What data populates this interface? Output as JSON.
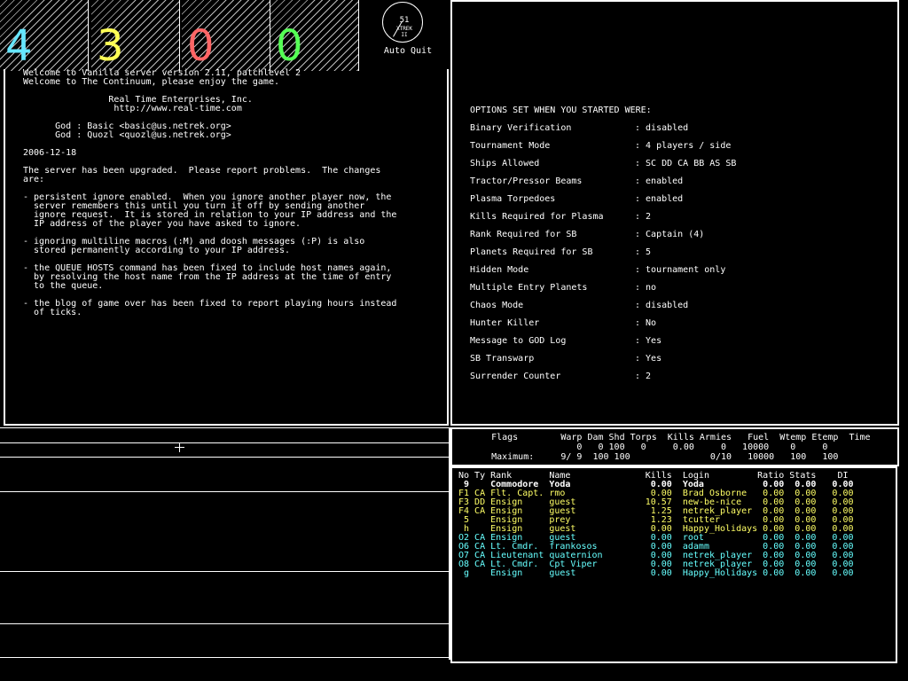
{
  "teams": [
    {
      "num": "4",
      "color": "#66e6ff"
    },
    {
      "num": "3",
      "color": "#ffff55"
    },
    {
      "num": "0",
      "color": "#ff6666"
    },
    {
      "num": "0",
      "color": "#55ff55"
    }
  ],
  "clock": {
    "value": "51",
    "line1": "XTREK",
    "line2": "II",
    "label": "Auto Quit"
  },
  "motd": [
    "Welcome to Vanilla server version 2.11, patchlevel 2",
    "Welcome to The Continuum, please enjoy the game.",
    "",
    "                Real Time Enterprises, Inc.",
    "                 http://www.real-time.com",
    "",
    "      God : Basic <basic@us.netrek.org>",
    "      God : Quozl <quozl@us.netrek.org>",
    "",
    "2006-12-18",
    "",
    "The server has been upgraded.  Please report problems.  The changes",
    "are:",
    "",
    "- persistent ignore enabled.  When you ignore another player now, the",
    "  server remembers this until you turn it off by sending another",
    "  ignore request.  It is stored in relation to your IP address and the",
    "  IP address of the player you have asked to ignore.",
    "",
    "- ignoring multiline macros (:M) and doosh messages (:P) is also",
    "  stored permanently according to your IP address.",
    "",
    "- the QUEUE HOSTS command has been fixed to include host names again,",
    "  by resolving the host name from the IP address at the time of entry",
    "  to the queue.",
    "",
    "- the blog of game over has been fixed to report playing hours instead",
    "  of ticks."
  ],
  "options": {
    "header": "OPTIONS SET WHEN YOU STARTED WERE:",
    "items": [
      {
        "label": "Binary Verification",
        "value": ": disabled"
      },
      {
        "label": "Tournament Mode",
        "value": ": 4 players / side"
      },
      {
        "label": "Ships Allowed",
        "value": ": SC DD CA BB AS SB"
      },
      {
        "label": "Tractor/Pressor Beams",
        "value": ": enabled"
      },
      {
        "label": "Plasma Torpedoes",
        "value": ": enabled"
      },
      {
        "label": "Kills Required for Plasma",
        "value": ": 2"
      },
      {
        "label": "Rank Required for SB",
        "value": ": Captain (4)"
      },
      {
        "label": "Planets Required for SB",
        "value": ": 5"
      },
      {
        "label": "Hidden Mode",
        "value": ": tournament only"
      },
      {
        "label": "Multiple Entry Planets",
        "value": ": no"
      },
      {
        "label": "Chaos Mode",
        "value": ": disabled"
      },
      {
        "label": "Hunter Killer",
        "value": ": No"
      },
      {
        "label": "Message to GOD Log",
        "value": ": Yes"
      },
      {
        "label": "SB Transwarp",
        "value": ": Yes"
      },
      {
        "label": "Surrender Counter",
        "value": ": 2"
      }
    ]
  },
  "stats": {
    "header": "    Flags        Warp Dam Shd Torps  Kills Armies   Fuel  Wtemp Etemp  Time",
    "current": "                    0   0 100   0     0.00     0   10000    0     0",
    "maximum": "    Maximum:     9/ 9  100 100               0/10   10000   100   100"
  },
  "players": {
    "header": "No Ty Rank       Name              Kills  Login         Ratio Stats    DI",
    "rows": [
      {
        "text": " 9    Commodore  Yoda               0.00  Yoda           0.00  0.00   0.00",
        "cls": "white bold"
      },
      {
        "text": "F1 CA Flt. Capt. rmo                0.00  Brad Osborne   0.00  0.00   0.00",
        "cls": "yellow"
      },
      {
        "text": "F3 DD Ensign     guest             10.57  new-be-nice    0.00  0.00   0.00",
        "cls": "yellow"
      },
      {
        "text": "F4 CA Ensign     guest              1.25  netrek_player  0.00  0.00   0.00",
        "cls": "yellow"
      },
      {
        "text": " 5    Ensign     prey               1.23  tcutter        0.00  0.00   0.00",
        "cls": "yellow"
      },
      {
        "text": " h    Ensign     guest              0.00  Happy_Holidays 0.00  0.00   0.00",
        "cls": "yellow"
      },
      {
        "text": "O2 CA Ensign     guest              0.00  root           0.00  0.00   0.00",
        "cls": "cyan"
      },
      {
        "text": "O6 CA Lt. Cmdr.  frankosos          0.00  adamm          0.00  0.00   0.00",
        "cls": "cyan"
      },
      {
        "text": "O7 CA Lieutenant quaternion         0.00  netrek_player  0.00  0.00   0.00",
        "cls": "cyan"
      },
      {
        "text": "O8 CA Lt. Cmdr.  Cpt Viper          0.00  netrek_player  0.00  0.00   0.00",
        "cls": "cyan"
      },
      {
        "text": " g    Ensign     guest              0.00  Happy_Holidays 0.00  0.00   0.00",
        "cls": "cyan"
      }
    ]
  }
}
